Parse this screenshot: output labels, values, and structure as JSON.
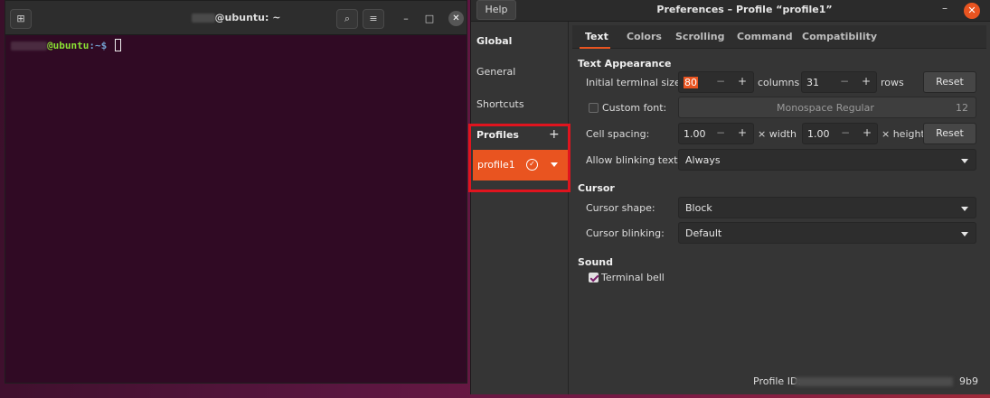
{
  "terminal": {
    "title_suffix": "@ubuntu: ~",
    "prompt_user": "@ubuntu",
    "prompt_path": ":~$"
  },
  "preferences": {
    "title": "Preferences – Profile “profile1”",
    "help": "Help",
    "sidebar": {
      "global": "Global",
      "general": "General",
      "shortcuts": "Shortcuts",
      "profiles": "Profiles",
      "profile_name": "profile1"
    },
    "tabs": [
      "Text",
      "Colors",
      "Scrolling",
      "Command",
      "Compatibility"
    ],
    "text_appearance": {
      "heading": "Text Appearance",
      "initial_size_label": "Initial terminal size:",
      "columns_value": "80",
      "columns_label": "columns",
      "rows_value": "31",
      "rows_label": "rows",
      "reset": "Reset",
      "custom_font_label": "Custom font:",
      "font_name": "Monospace Regular",
      "font_size": "12",
      "cell_spacing_label": "Cell spacing:",
      "width_value": "1.00",
      "width_label": "× width",
      "height_value": "1.00",
      "height_label": "× height",
      "blinking_label": "Allow blinking text:",
      "blinking_value": "Always"
    },
    "cursor": {
      "heading": "Cursor",
      "shape_label": "Cursor shape:",
      "shape_value": "Block",
      "blinking_label": "Cursor blinking:",
      "blinking_value": "Default"
    },
    "sound": {
      "heading": "Sound",
      "bell_label": "Terminal bell"
    },
    "profile_id_label": "Profile ID:",
    "profile_id_tail": "9b9"
  },
  "colors": {
    "accent": "#e95420",
    "highlight_border": "#e0141e",
    "terminal_bg": "#300a24"
  }
}
